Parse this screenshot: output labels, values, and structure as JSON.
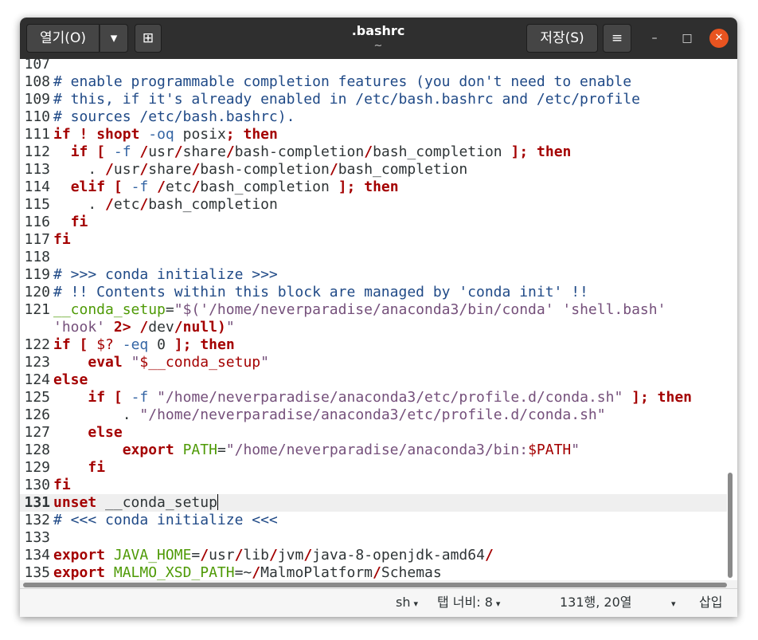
{
  "window": {
    "title": ".bashrc",
    "subtitle": "~",
    "open_label": "열기(O)",
    "open_dropdown_icon": "▾",
    "new_tab_icon": "⊞",
    "save_label": "저장(S)",
    "menu_icon": "≡",
    "minimize_icon": "–",
    "maximize_icon": "□",
    "close_icon": "✕"
  },
  "status": {
    "language": "sh",
    "tab_width": "탭 너비: 8",
    "position": "131행, 20열",
    "dropdown_icon": "▾",
    "insert_mode": "삽입"
  },
  "editor": {
    "cursor_line": "131",
    "lines": [
      {
        "n": "107",
        "t": ""
      },
      {
        "n": "108",
        "t": "# enable programmable completion features (you don't need to enable"
      },
      {
        "n": "109",
        "t": "# this, if it's already enabled in /etc/bash.bashrc and /etc/profile"
      },
      {
        "n": "110",
        "t": "# sources /etc/bash.bashrc)."
      },
      {
        "n": "111",
        "t": "if ! shopt -oq posix; then"
      },
      {
        "n": "112",
        "t": "  if [ -f /usr/share/bash-completion/bash_completion ]; then"
      },
      {
        "n": "113",
        "t": "    . /usr/share/bash-completion/bash_completion"
      },
      {
        "n": "114",
        "t": "  elif [ -f /etc/bash_completion ]; then"
      },
      {
        "n": "115",
        "t": "    . /etc/bash_completion"
      },
      {
        "n": "116",
        "t": "  fi"
      },
      {
        "n": "117",
        "t": "fi"
      },
      {
        "n": "118",
        "t": ""
      },
      {
        "n": "119",
        "t": "# >>> conda initialize >>>"
      },
      {
        "n": "120",
        "t": "# !! Contents within this block are managed by 'conda init' !!"
      },
      {
        "n": "121",
        "t": "__conda_setup=\"$('/home/neverparadise/anaconda3/bin/conda' 'shell.bash'"
      },
      {
        "n": "",
        "t": "'hook' 2> /dev/null)\""
      },
      {
        "n": "122",
        "t": "if [ $? -eq 0 ]; then"
      },
      {
        "n": "123",
        "t": "    eval \"$__conda_setup\""
      },
      {
        "n": "124",
        "t": "else"
      },
      {
        "n": "125",
        "t": "    if [ -f \"/home/neverparadise/anaconda3/etc/profile.d/conda.sh\" ]; then"
      },
      {
        "n": "126",
        "t": "        . \"/home/neverparadise/anaconda3/etc/profile.d/conda.sh\""
      },
      {
        "n": "127",
        "t": "    else"
      },
      {
        "n": "128",
        "t": "        export PATH=\"/home/neverparadise/anaconda3/bin:$PATH\""
      },
      {
        "n": "129",
        "t": "    fi"
      },
      {
        "n": "130",
        "t": "fi"
      },
      {
        "n": "131",
        "t": "unset __conda_setup"
      },
      {
        "n": "132",
        "t": "# <<< conda initialize <<<"
      },
      {
        "n": "133",
        "t": ""
      },
      {
        "n": "134",
        "t": "export JAVA_HOME=/usr/lib/jvm/java-8-openjdk-amd64/"
      },
      {
        "n": "135",
        "t": "export MALMO_XSD_PATH=~/MalmoPlatform/Schemas"
      }
    ]
  }
}
